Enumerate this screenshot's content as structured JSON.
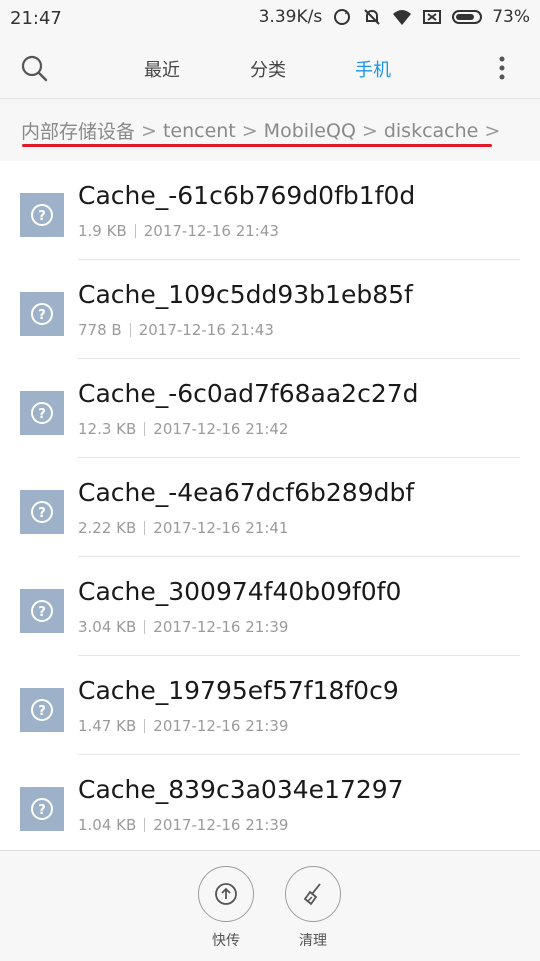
{
  "status_bar": {
    "time": "21:47",
    "speed": "3.39K/s",
    "battery": "73%"
  },
  "toolbar": {
    "tabs": [
      {
        "label": "最近"
      },
      {
        "label": "分类"
      },
      {
        "label": "手机"
      }
    ],
    "active_tab_color": "#1e96e6"
  },
  "breadcrumb": {
    "items": [
      "内部存储设备",
      "tencent",
      "MobileQQ",
      "diskcache"
    ],
    "separator": ">"
  },
  "files": [
    {
      "name": "Cache_-61c6b769d0fb1f0d",
      "size": "1.9 KB",
      "date": "2017-12-16 21:43"
    },
    {
      "name": "Cache_109c5dd93b1eb85f",
      "size": "778 B",
      "date": "2017-12-16 21:43"
    },
    {
      "name": "Cache_-6c0ad7f68aa2c27d",
      "size": "12.3 KB",
      "date": "2017-12-16 21:42"
    },
    {
      "name": "Cache_-4ea67dcf6b289dbf",
      "size": "2.22 KB",
      "date": "2017-12-16 21:41"
    },
    {
      "name": "Cache_300974f40b09f0f0",
      "size": "3.04 KB",
      "date": "2017-12-16 21:39"
    },
    {
      "name": "Cache_19795ef57f18f0c9",
      "size": "1.47 KB",
      "date": "2017-12-16 21:39"
    },
    {
      "name": "Cache_839c3a034e17297",
      "size": "1.04 KB",
      "date": "2017-12-16 21:39"
    }
  ],
  "bottom_actions": {
    "transfer_label": "快传",
    "clean_label": "清理"
  },
  "colors": {
    "accent": "#1e96e6",
    "highlight_underline": "#e0192b",
    "file_icon": "#9db2c8"
  }
}
